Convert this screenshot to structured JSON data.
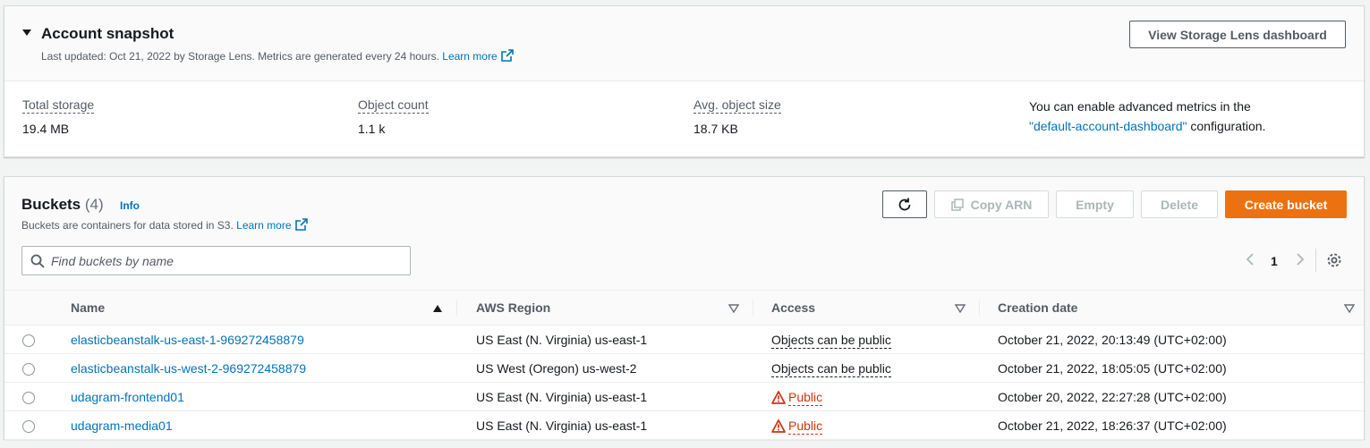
{
  "snapshot": {
    "title": "Account snapshot",
    "last_updated": "Last updated: Oct 21, 2022 by Storage Lens. Metrics are generated every 24 hours.",
    "learn_more": "Learn more",
    "view_dashboard": "View Storage Lens dashboard",
    "metrics": [
      {
        "label": "Total storage",
        "value": "19.4 MB"
      },
      {
        "label": "Object count",
        "value": "1.1 k"
      },
      {
        "label": "Avg. object size",
        "value": "18.7 KB"
      }
    ],
    "advanced_prefix": "You can enable advanced metrics in the",
    "advanced_link": "\"default-account-dashboard\"",
    "advanced_suffix": "configuration."
  },
  "buckets": {
    "title": "Buckets",
    "count": "(4)",
    "info": "Info",
    "subtitle": "Buckets are containers for data stored in S3.",
    "learn_more": "Learn more",
    "buttons": {
      "copy_arn": "Copy ARN",
      "empty": "Empty",
      "delete": "Delete",
      "create": "Create bucket"
    },
    "search_placeholder": "Find buckets by name",
    "page": "1",
    "columns": [
      "Name",
      "AWS Region",
      "Access",
      "Creation date"
    ],
    "rows": [
      {
        "name": "elasticbeanstalk-us-east-1-969272458879",
        "region": "US East (N. Virginia) us-east-1",
        "access": "Objects can be public",
        "access_type": "objects",
        "created": "October 21, 2022, 20:13:49 (UTC+02:00)"
      },
      {
        "name": "elasticbeanstalk-us-west-2-969272458879",
        "region": "US West (Oregon) us-west-2",
        "access": "Objects can be public",
        "access_type": "objects",
        "created": "October 21, 2022, 18:05:05 (UTC+02:00)"
      },
      {
        "name": "udagram-frontend01",
        "region": "US East (N. Virginia) us-east-1",
        "access": "Public",
        "access_type": "public",
        "created": "October 20, 2022, 22:27:28 (UTC+02:00)"
      },
      {
        "name": "udagram-media01",
        "region": "US East (N. Virginia) us-east-1",
        "access": "Public",
        "access_type": "public",
        "created": "October 21, 2022, 18:26:37 (UTC+02:00)"
      }
    ]
  },
  "colors": {
    "link": "#0073bb",
    "primary": "#ec7211",
    "warning": "#d13212"
  }
}
